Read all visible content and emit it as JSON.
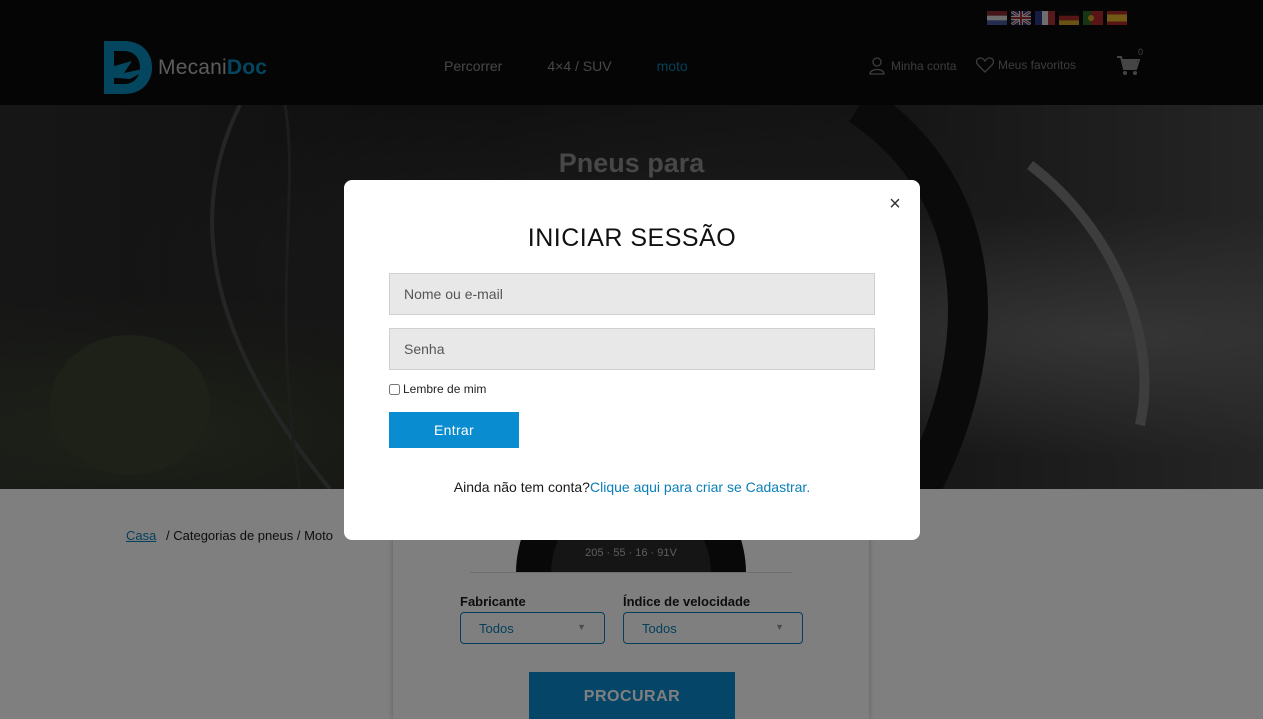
{
  "header": {
    "logo": {
      "prefix": "Mecani",
      "suffix": "Doc"
    },
    "flags": [
      "nl-flag-icon",
      "uk-flag-icon",
      "fr-flag-icon",
      "de-flag-icon",
      "pt-flag-icon",
      "es-flag-icon"
    ],
    "nav": [
      {
        "label": "Percorrer"
      },
      {
        "label": "4×4 / SUV"
      },
      {
        "label": "moto"
      }
    ],
    "account_label": "Minha conta",
    "favorites_label": "Meus favoritos",
    "cart_count": "0"
  },
  "hero": {
    "title": "Pneus para"
  },
  "breadcrumb": {
    "home": "Casa",
    "sep1": "/",
    "categories": "Categorias de pneus",
    "sep2": "/",
    "current": "Moto"
  },
  "search": {
    "manufacturer_label": "Fabricante",
    "manufacturer_value": "Todos",
    "speed_label": "Índice de velocidade",
    "speed_value": "Todos",
    "button": "PROCURAR",
    "tire_text": "205 · 55 · 16 · 91V"
  },
  "modal": {
    "title": "INICIAR SESSÃO",
    "username_placeholder": "Nome ou e-mail",
    "password_placeholder": "Senha",
    "remember_label": "Lembre de mim",
    "submit_label": "Entrar",
    "signup_prompt": "Ainda não tem conta?",
    "signup_link": "Clique aqui para criar se Cadastrar.",
    "close": "×"
  },
  "colors": {
    "accent": "#0a8cd0",
    "link": "#0a7fb8",
    "header_bg": "#0b0b0b"
  }
}
